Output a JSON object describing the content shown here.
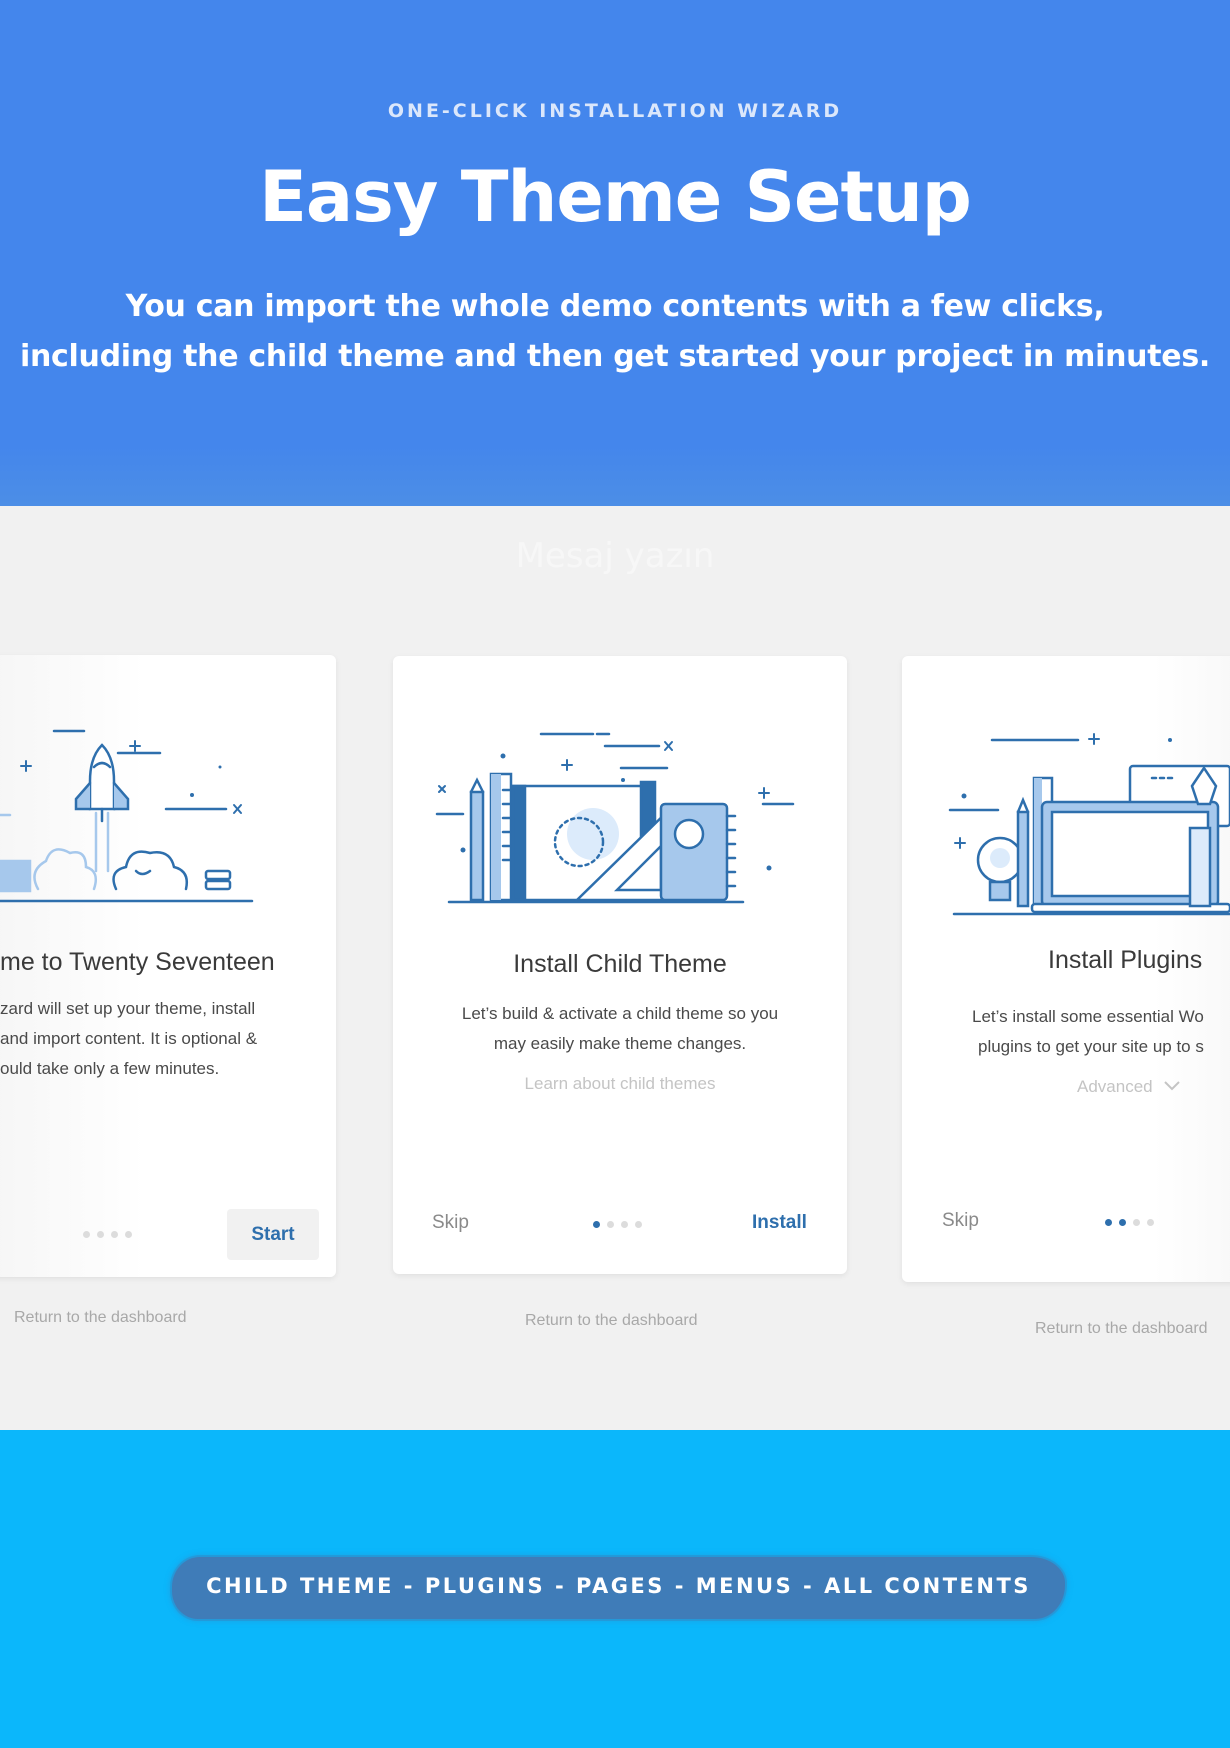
{
  "hero": {
    "eyebrow": "ONE-CLICK INSTALLATION WIZARD",
    "title": "Easy Theme Setup",
    "subtitle_line1": "You can import the whole demo contents with a few clicks,",
    "subtitle_line2": "including the child theme and then get started your project in minutes."
  },
  "showcase": {
    "ghost_text": "Mesaj yazın",
    "cards": [
      {
        "title": "me to Twenty Seventeen",
        "text_lines": [
          "zard will set up your theme, install",
          "and import content. It is optional &",
          "ould take only a few minutes."
        ],
        "action": "Start",
        "dots_total": 4,
        "dots_active": 0,
        "return_link": "Return to the dashboard",
        "illustration": "rocket-launch-icon"
      },
      {
        "title": "Install Child Theme",
        "text_lines": [
          "Let’s build & activate a child theme so you",
          "may easily make theme changes."
        ],
        "link": "Learn about child themes",
        "skip": "Skip",
        "action": "Install",
        "dots_total": 4,
        "dots_active": 1,
        "return_link": "Return to the dashboard",
        "illustration": "design-tools-icon"
      },
      {
        "title": "Install Plugins",
        "text_lines": [
          "Let’s install some essential Wo",
          "plugins to get your site up to s"
        ],
        "link": "Advanced",
        "skip": "Skip",
        "dots_total": 4,
        "dots_active": 2,
        "return_link": "Return to the dashboard",
        "illustration": "laptop-workspace-icon"
      }
    ]
  },
  "band": {
    "label": "CHILD THEME - PLUGINS - PAGES - MENUS - ALL CONTENTS"
  },
  "colors": {
    "hero_bg": "#4486ec",
    "band_bg": "#0bb7fb",
    "brush": "#3f7cb8",
    "accent": "#2e6fad"
  }
}
